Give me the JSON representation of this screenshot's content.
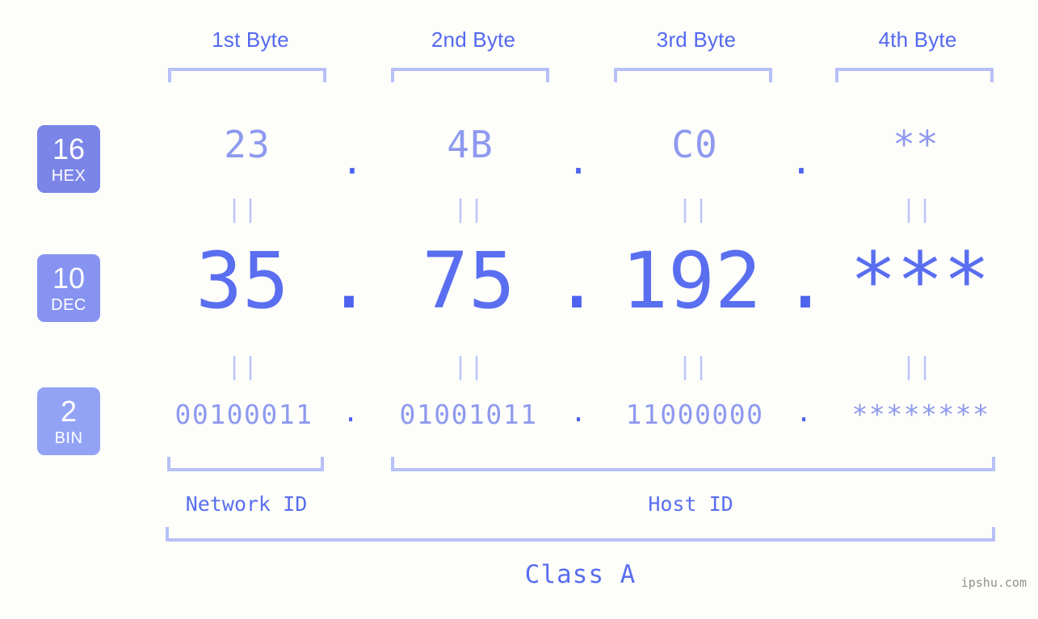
{
  "meta": {
    "background": "#fdfefa",
    "accent_strong": "#5a6ef0",
    "accent_light": "#8e99ef",
    "bracket_color": "#b7c0f7",
    "eq_color": "#bcc5f8",
    "watermark": "ipshu.com"
  },
  "headers": [
    {
      "label": "1st Byte"
    },
    {
      "label": "2nd Byte"
    },
    {
      "label": "3rd Byte"
    },
    {
      "label": "4th Byte"
    }
  ],
  "bases": [
    {
      "num": "16",
      "name": "HEX",
      "color": "#7b85e8"
    },
    {
      "num": "10",
      "name": "DEC",
      "color": "#8793f0"
    },
    {
      "num": "2",
      "name": "BIN",
      "color": "#92a3f5"
    }
  ],
  "rows": {
    "hex": {
      "base": "16",
      "name": "HEX",
      "values": [
        "23",
        "4B",
        "C0",
        "**"
      ],
      "separator": "."
    },
    "dec": {
      "base": "10",
      "name": "DEC",
      "values": [
        "35",
        "75",
        "192",
        "***"
      ],
      "separator": "."
    },
    "bin": {
      "base": "2",
      "name": "BIN",
      "values": [
        "00100011",
        "01001011",
        "11000000",
        "********"
      ],
      "separator": "."
    }
  },
  "equals_marks": [
    "||",
    "||",
    "||",
    "||",
    "||",
    "||",
    "||",
    "||"
  ],
  "footer": {
    "network_id": "Network ID",
    "host_id": "Host ID",
    "class_label": "Class A"
  }
}
